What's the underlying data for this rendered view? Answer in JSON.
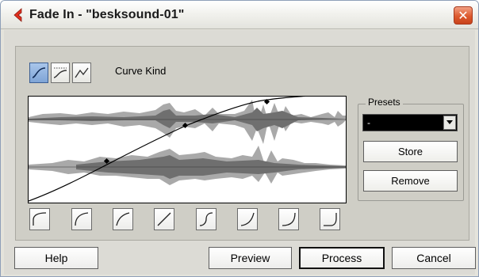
{
  "window": {
    "title": "Fade In - \"besksound-01\"",
    "close_glyph": "✕"
  },
  "curve_kind": {
    "label": "Curve Kind",
    "buttons": [
      "spline-curve-icon",
      "damped-spline-curve-icon",
      "linear-curve-icon"
    ],
    "active_index": 0
  },
  "presets": {
    "group_label": "Presets",
    "selected": "-",
    "store_label": "Store",
    "remove_label": "Remove"
  },
  "preset_shapes": [
    "convex-fade-1-icon",
    "convex-fade-2-icon",
    "convex-fade-3-icon",
    "linear-fade-icon",
    "s-curve-fade-icon",
    "concave-fade-1-icon",
    "concave-fade-2-icon",
    "concave-fade-3-icon"
  ],
  "buttons": {
    "help": "Help",
    "preview": "Preview",
    "process": "Process",
    "cancel": "Cancel"
  },
  "colors": {
    "window_bg": "#dcdbd5",
    "panel_bg": "#cfcec6",
    "close_red": "#dd5a2e",
    "active_blue": "#7fa4d6"
  }
}
